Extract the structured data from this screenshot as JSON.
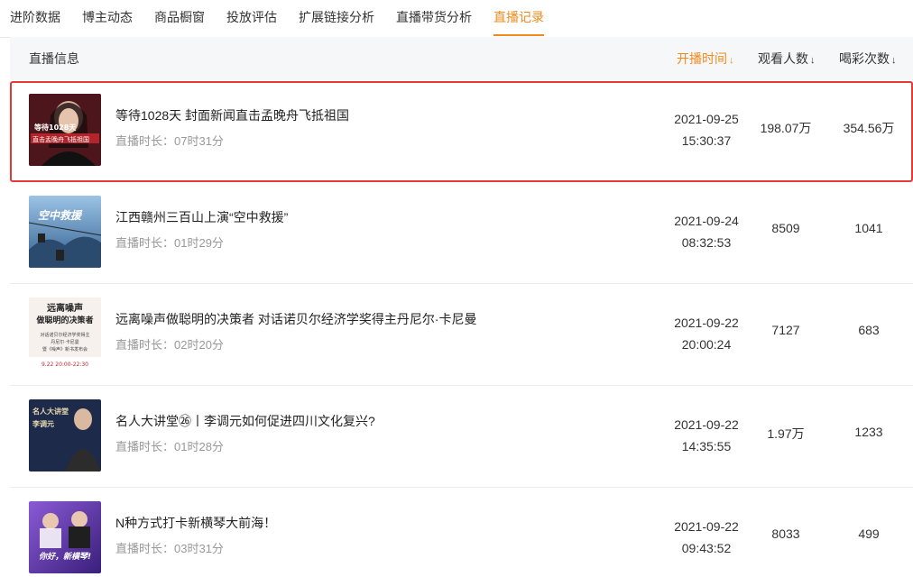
{
  "tabs": [
    {
      "label": "进阶数据",
      "active": false
    },
    {
      "label": "博主动态",
      "active": false
    },
    {
      "label": "商品橱窗",
      "active": false
    },
    {
      "label": "投放评估",
      "active": false
    },
    {
      "label": "扩展链接分析",
      "active": false
    },
    {
      "label": "直播带货分析",
      "active": false
    },
    {
      "label": "直播记录",
      "active": true
    }
  ],
  "table": {
    "headers": {
      "info": "直播信息",
      "start_time": "开播时间",
      "viewers": "观看人数",
      "cheers": "喝彩次数"
    },
    "sort_icon": "↓",
    "duration_prefix": "直播时长：",
    "rows": [
      {
        "title": "等待1028天 封面新闻直击孟晚舟飞抵祖国",
        "duration": "07时31分",
        "date": "2021-09-25",
        "time": "15:30:37",
        "viewers": "198.07万",
        "cheers": "354.56万",
        "thumb_text": [
          "等待1028天",
          "直击孟晚舟飞抵祖国"
        ],
        "highlight": true,
        "thumb_color": "#6b1c24"
      },
      {
        "title": "江西赣州三百山上演“空中救援”",
        "duration": "01时29分",
        "date": "2021-09-24",
        "time": "08:32:53",
        "viewers": "8509",
        "cheers": "1041",
        "thumb_text": [
          "空中救援"
        ],
        "highlight": false,
        "thumb_color": "#3b6fa8"
      },
      {
        "title": "远离噪声做聪明的决策者 对话诺贝尔经济学奖得主丹尼尔·卡尼曼",
        "duration": "02时20分",
        "date": "2021-09-22",
        "time": "20:00:24",
        "viewers": "7127",
        "cheers": "683",
        "thumb_text": [
          "远离噪声",
          "做聪明的决策者",
          "对话诺贝尔经济学奖得主",
          "丹尼尔·卡尼曼",
          "暨《噪声》新书发布会",
          "9.22 20:00-22:30"
        ],
        "highlight": false,
        "thumb_color": "#f7f1ee"
      },
      {
        "title": "名人大讲堂㉖丨李调元如何促进四川文化复兴?",
        "duration": "01时28分",
        "date": "2021-09-22",
        "time": "14:35:55",
        "viewers": "1.97万",
        "cheers": "1233",
        "thumb_text": [
          "名人大讲堂",
          "李调元"
        ],
        "highlight": false,
        "thumb_color": "#1d2a4a"
      },
      {
        "title": "N种方式打卡新横琴大前海！",
        "duration": "03时31分",
        "date": "2021-09-22",
        "time": "09:43:52",
        "viewers": "8033",
        "cheers": "499",
        "thumb_text": [
          "你好，新横琴!"
        ],
        "highlight": false,
        "thumb_color": "#6a3fb5"
      }
    ]
  },
  "colors": {
    "accent": "#f08a1c",
    "highlight_border": "#e53935"
  }
}
